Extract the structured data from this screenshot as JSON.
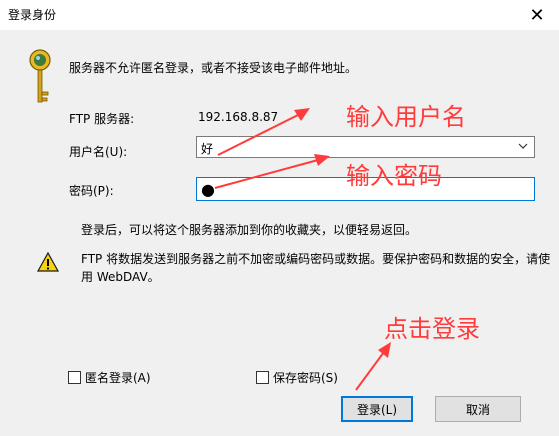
{
  "window": {
    "title": "登录身份",
    "close_glyph": "✕"
  },
  "message": "服务器不允许匿名登录，或者不接受该电子邮件地址。",
  "ftp": {
    "label": "FTP 服务器:",
    "value": "192.168.8.87"
  },
  "user": {
    "label": "用户名(U):",
    "value": "好"
  },
  "password": {
    "label": "密码(P):",
    "value": "●"
  },
  "note": "登录后，可以将这个服务器添加到你的收藏夹，以便轻易返回。",
  "warning": "FTP 将数据发送到服务器之前不加密或编码密码或数据。要保护密码和数据的安全，请使用 WebDAV。",
  "checkboxes": {
    "anonymous": "匿名登录(A)",
    "save_password": "保存密码(S)"
  },
  "buttons": {
    "login": "登录(L)",
    "cancel": "取消"
  },
  "annotations": {
    "enter_username": "输入用户名",
    "enter_password": "输入密码",
    "click_login": "点击登录",
    "color": "#ff3b3b"
  },
  "icons": {
    "key": "key-icon",
    "warning": "warning-icon",
    "chevron": "chevron-down-icon",
    "close": "close-icon"
  }
}
